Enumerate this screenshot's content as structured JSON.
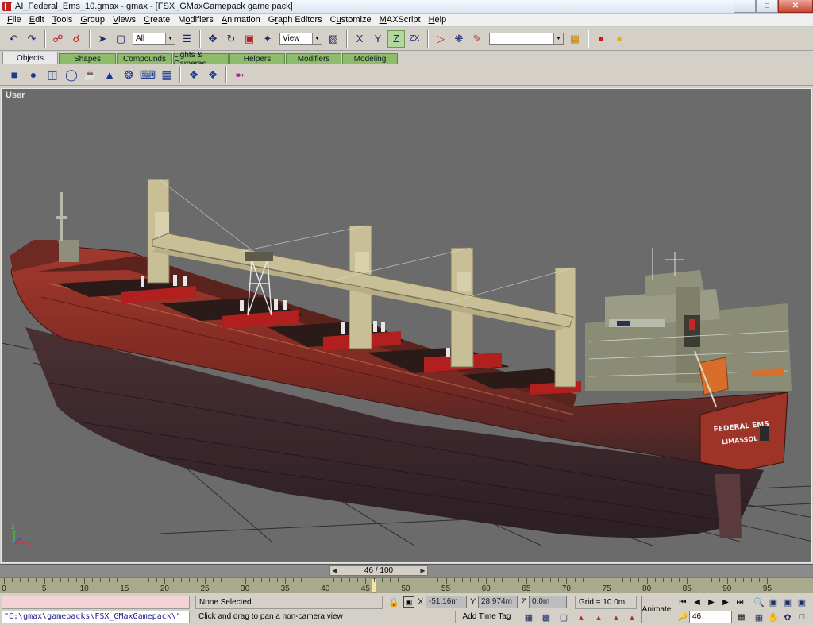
{
  "window": {
    "title": "AI_Federal_Ems_10.gmax - gmax - [FSX_GMaxGamepack game pack]",
    "minimize_icon": "minimize-icon",
    "maximize_icon": "maximize-icon",
    "close_icon": "close-icon"
  },
  "menu": {
    "items": [
      {
        "label": "File",
        "key": "F"
      },
      {
        "label": "Edit",
        "key": "E"
      },
      {
        "label": "Tools",
        "key": "T"
      },
      {
        "label": "Group",
        "key": "G"
      },
      {
        "label": "Views",
        "key": "V"
      },
      {
        "label": "Create",
        "key": "C"
      },
      {
        "label": "Modifiers",
        "key": "o"
      },
      {
        "label": "Animation",
        "key": "A"
      },
      {
        "label": "Graph Editors",
        "key": "r"
      },
      {
        "label": "Customize",
        "key": "u"
      },
      {
        "label": "MAXScript",
        "key": "M"
      },
      {
        "label": "Help",
        "key": "H"
      }
    ]
  },
  "toolbar": {
    "selection_filter": "All",
    "reference_coord": "View",
    "named_selection": "",
    "buttons": [
      "undo-icon",
      "redo-icon",
      "link-icon",
      "unlink-icon",
      "select-icon",
      "region-select-icon",
      "select-by-name-icon",
      "move-icon",
      "rotate-icon",
      "scale-icon",
      "mirror-icon",
      "restrict-x-icon",
      "restrict-y-icon",
      "restrict-z-icon",
      "restrict-zx-icon",
      "mirror-tool-icon",
      "align-icon",
      "material-icon",
      "render-icon",
      "quick-render-icon"
    ]
  },
  "tabs": [
    {
      "label": "Objects",
      "active": true
    },
    {
      "label": "Shapes",
      "active": false
    },
    {
      "label": "Compounds",
      "active": false
    },
    {
      "label": "Lights & Cameras",
      "active": false
    },
    {
      "label": "Helpers",
      "active": false
    },
    {
      "label": "Modifiers",
      "active": false
    },
    {
      "label": "Modeling",
      "active": false
    }
  ],
  "create_panel": {
    "buttons": [
      "box-icon",
      "sphere-icon",
      "cylinder-icon",
      "torus-icon",
      "teapot-icon",
      "cone-icon",
      "geosphere-icon",
      "tube-icon",
      "plane-icon",
      "hedra-icon",
      "scatter-icon",
      "particle-icon"
    ]
  },
  "viewport": {
    "label": "User",
    "ship_name": "FEDERAL EMS",
    "ship_port": "LIMASSOL"
  },
  "time_slider": {
    "frame_text": "46 / 100",
    "current_frame": 46,
    "total_frames": 100
  },
  "track_bar": {
    "tick_labels": [
      "0",
      "5",
      "10",
      "15",
      "20",
      "25",
      "30",
      "35",
      "40",
      "45",
      "50",
      "55",
      "60",
      "65",
      "70",
      "75",
      "80",
      "85",
      "90",
      "95"
    ],
    "key_frame": 46
  },
  "status": {
    "maxscript_command": "",
    "maxscript_output": "\"C:\\gmax\\gamepacks\\FSX_GMaxGamepack\\\"",
    "selection": "None Selected",
    "prompt": "Click and drag to pan a non-camera view",
    "x_label": "X",
    "x_value": "-51.16m",
    "y_label": "Y",
    "y_value": "28.974m",
    "z_label": "Z",
    "z_value": "0.0m",
    "grid": "Grid = 10.0m",
    "add_time_tag": "Add Time Tag",
    "animate": "Animate",
    "frame_field": "46"
  },
  "colors": {
    "viewport_bg": "#6b6b6b",
    "hull_red": "#8e2d24",
    "superstructure": "#8a8c76",
    "crane": "#c9bf96",
    "tab_green": "#8dbc6a",
    "trackbar": "#a9a98c"
  }
}
